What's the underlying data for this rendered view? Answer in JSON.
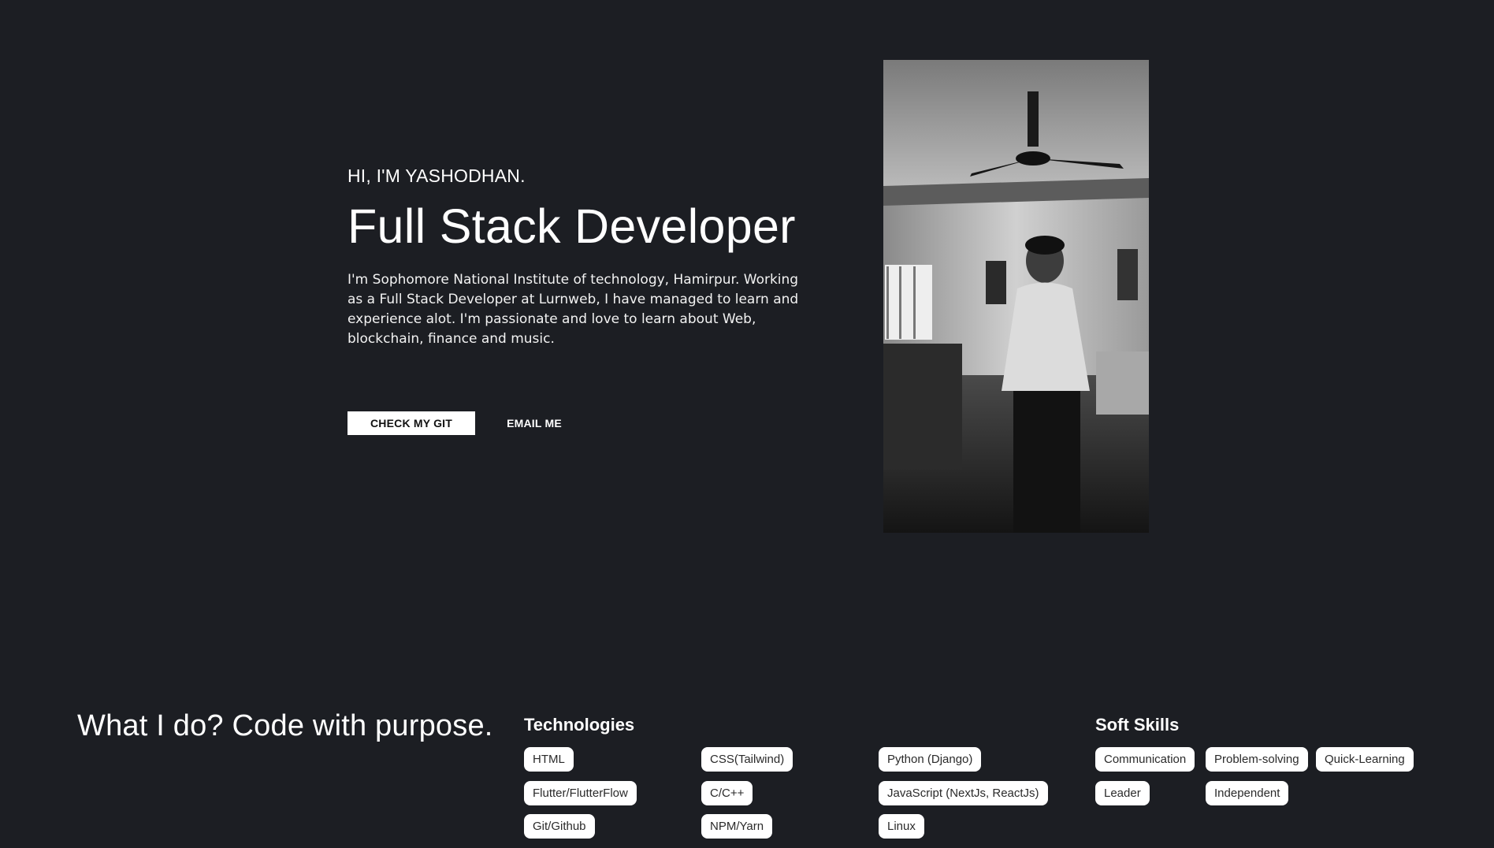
{
  "hero": {
    "greeting": "HI, I'M YASHODHAN.",
    "title": "Full Stack Developer",
    "bio": "I'm Sophomore National Institute of technology, Hamirpur. Working as a Full Stack Developer at Lurnweb, I have managed to learn and experience alot. I'm passionate and love to learn about Web, blockchain, finance and music.",
    "git_button": "CHECK MY GIT",
    "email_button": "EMAIL ME"
  },
  "photo": {
    "icon": "portrait-photo"
  },
  "skills": {
    "heading": "What I do? Code with purpose.",
    "technologies_title": "Technologies",
    "technologies": [
      "HTML",
      "CSS(Tailwind)",
      "Python (Django)",
      "Flutter/FlutterFlow",
      "C/C++",
      "JavaScript (NextJs, ReactJs)",
      "Git/Github",
      "NPM/Yarn",
      "Linux"
    ],
    "soft_title": "Soft Skills",
    "soft": [
      "Communication",
      "Problem-solving",
      "Quick-Learning",
      "Leader",
      "Independent"
    ]
  },
  "colors": {
    "background": "#1c1e23",
    "text": "#ffffff",
    "chip_bg": "#ffffff",
    "chip_text": "#2a2a2a"
  }
}
